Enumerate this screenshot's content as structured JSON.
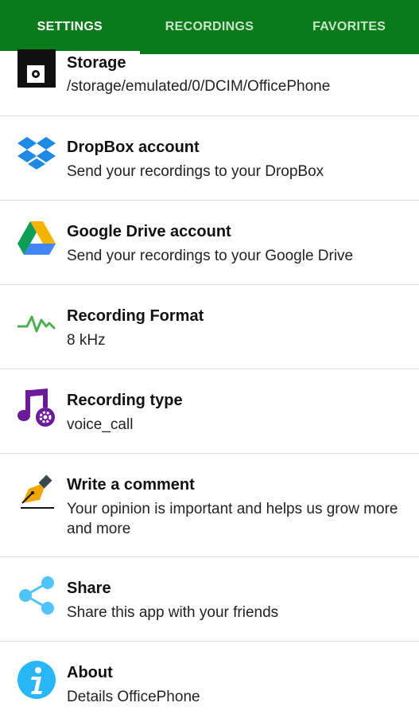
{
  "tabs": [
    {
      "label": "SETTINGS",
      "active": true
    },
    {
      "label": "RECORDINGS",
      "active": false
    },
    {
      "label": "FAVORITES",
      "active": false
    }
  ],
  "colors": {
    "tabbar": "#0b7a1a",
    "tab_active": "#ffffff",
    "tab_inactive": "#c8e6c9",
    "dropbox": "#1e88e5",
    "drive_green": "#0f9d58",
    "drive_yellow": "#f4b400",
    "drive_blue": "#4285f4",
    "waveform": "#4caf50",
    "music": "#6a1b9a",
    "share": "#4fc3f7",
    "about": "#29b6f6"
  },
  "settings": [
    {
      "icon": "floppy-disk-icon",
      "title": "Storage",
      "subtitle": "/storage/emulated/0/DCIM/OfficePhone"
    },
    {
      "icon": "dropbox-icon",
      "title": "DropBox account",
      "subtitle": "Send your recordings to your DropBox"
    },
    {
      "icon": "google-drive-icon",
      "title": "Google Drive account",
      "subtitle": "Send your recordings to your Google Drive"
    },
    {
      "icon": "waveform-icon",
      "title": "Recording Format",
      "subtitle": "8 kHz"
    },
    {
      "icon": "music-gear-icon",
      "title": "Recording type",
      "subtitle": "voice_call"
    },
    {
      "icon": "fountain-pen-icon",
      "title": "Write a comment",
      "subtitle": "Your opinion is important and helps us grow more and more"
    },
    {
      "icon": "share-icon",
      "title": "Share",
      "subtitle": "Share this app with your friends"
    },
    {
      "icon": "info-icon",
      "title": "About",
      "subtitle": "Details OfficePhone"
    }
  ]
}
